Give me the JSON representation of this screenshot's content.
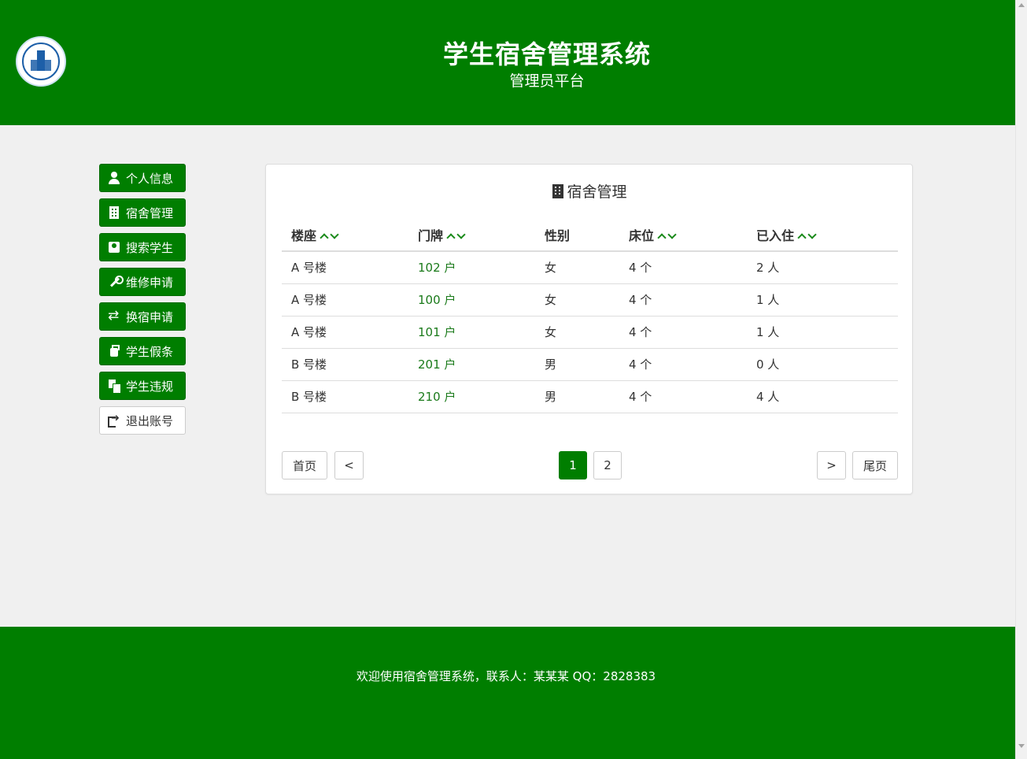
{
  "header": {
    "title": "学生宿舍管理系统",
    "subtitle": "管理员平台",
    "logo_icon": "university-seal-icon"
  },
  "sidebar": {
    "items": [
      {
        "label": "个人信息",
        "icon": "user-icon"
      },
      {
        "label": "宿舍管理",
        "icon": "building-icon"
      },
      {
        "label": "搜索学生",
        "icon": "id-card-icon"
      },
      {
        "label": "维修申请",
        "icon": "wrench-icon"
      },
      {
        "label": "换宿申请",
        "icon": "swap-icon"
      },
      {
        "label": "学生假条",
        "icon": "suitcase-icon"
      },
      {
        "label": "学生违规",
        "icon": "copy-icon"
      },
      {
        "label": "退出账号",
        "icon": "sign-out-icon"
      }
    ]
  },
  "panel": {
    "title": "宿舍管理",
    "columns": [
      "楼座",
      "门牌",
      "性别",
      "床位",
      "已入住"
    ],
    "rows": [
      [
        "A 号楼",
        "102 户",
        "女",
        "4 个",
        "2 人"
      ],
      [
        "A 号楼",
        "100 户",
        "女",
        "4 个",
        "1 人"
      ],
      [
        "A 号楼",
        "101 户",
        "女",
        "4 个",
        "1 人"
      ],
      [
        "B 号楼",
        "201 户",
        "男",
        "4 个",
        "0 人"
      ],
      [
        "B 号楼",
        "210 户",
        "男",
        "4 个",
        "4 人"
      ]
    ],
    "pagination": {
      "first": "首页",
      "prev": "<",
      "pages": [
        "1",
        "2"
      ],
      "current_page": "1",
      "next": ">",
      "last": "尾页"
    }
  },
  "footer": {
    "text": "欢迎使用宿舍管理系统，联系人：某某某 QQ：2828383"
  },
  "colors": {
    "brand_green": "#007e00",
    "link_green": "#1a7a1a"
  }
}
